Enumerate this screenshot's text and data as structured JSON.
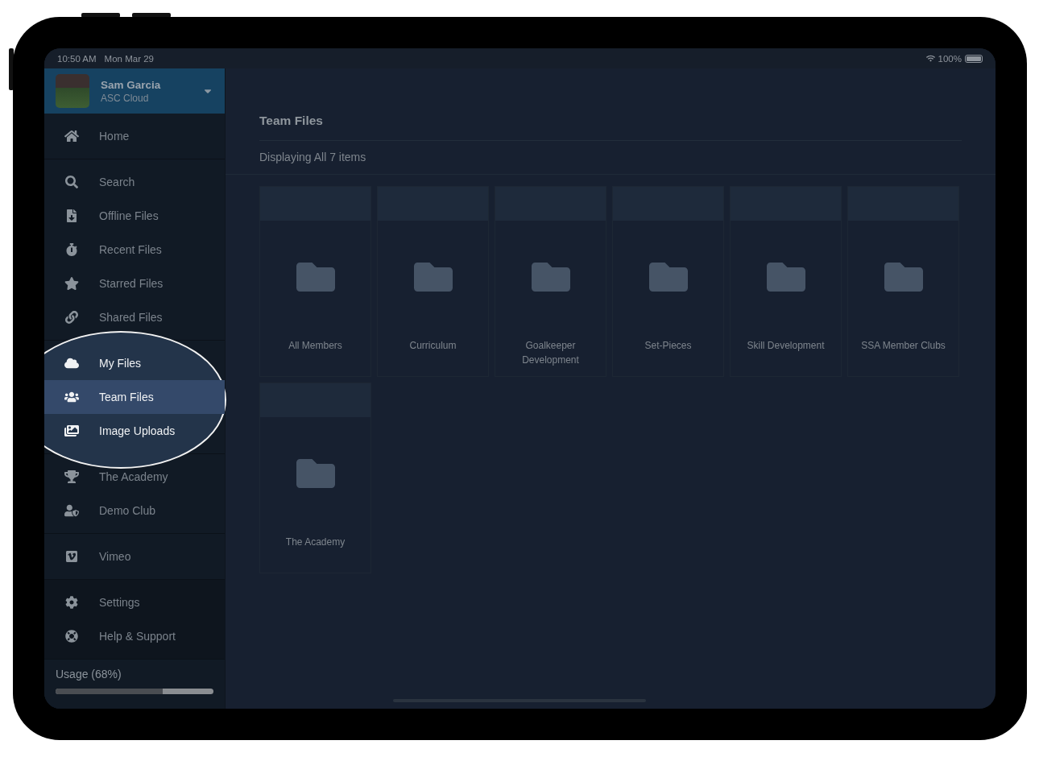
{
  "status_bar": {
    "time": "10:50 AM",
    "date": "Mon Mar 29",
    "battery": "100%"
  },
  "profile": {
    "name": "Sam Garcia",
    "subtitle": "ASC Cloud"
  },
  "sidebar": {
    "groups": [
      {
        "kind": "nav",
        "spotlighted": false,
        "items": [
          {
            "label": "Home",
            "selected": false
          }
        ]
      },
      {
        "kind": "nav",
        "spotlighted": false,
        "items": [
          {
            "label": "Search",
            "selected": false
          },
          {
            "label": "Offline Files",
            "selected": false
          },
          {
            "label": "Recent Files",
            "selected": false
          },
          {
            "label": "Starred Files",
            "selected": false
          },
          {
            "label": "Shared Files",
            "selected": false
          }
        ]
      },
      {
        "kind": "nav",
        "spotlighted": true,
        "items": [
          {
            "label": "My Files",
            "selected": false
          },
          {
            "label": "Team Files",
            "selected": true
          },
          {
            "label": "Image Uploads",
            "selected": false
          }
        ]
      },
      {
        "kind": "nav",
        "spotlighted": false,
        "items": [
          {
            "label": "The Academy",
            "selected": false
          },
          {
            "label": "Demo Club",
            "selected": false
          }
        ]
      },
      {
        "kind": "nav",
        "spotlighted": false,
        "items": [
          {
            "label": "Vimeo",
            "selected": false
          }
        ]
      },
      {
        "kind": "footer",
        "spotlighted": false,
        "items": [
          {
            "label": "Settings",
            "selected": false
          },
          {
            "label": "Help & Support",
            "selected": false
          }
        ]
      }
    ],
    "usage": {
      "label": "Usage (68%)",
      "level": 0.68
    }
  },
  "main": {
    "title": "Team Files",
    "subtitle": "Displaying All 7 items",
    "folders": [
      {
        "name": "All Members"
      },
      {
        "name": "Curriculum"
      },
      {
        "name": "Goalkeeper Development"
      },
      {
        "name": "Set-Pieces"
      },
      {
        "name": "Skill Development"
      },
      {
        "name": "SSA Member Clubs"
      },
      {
        "name": "The Academy"
      }
    ]
  }
}
